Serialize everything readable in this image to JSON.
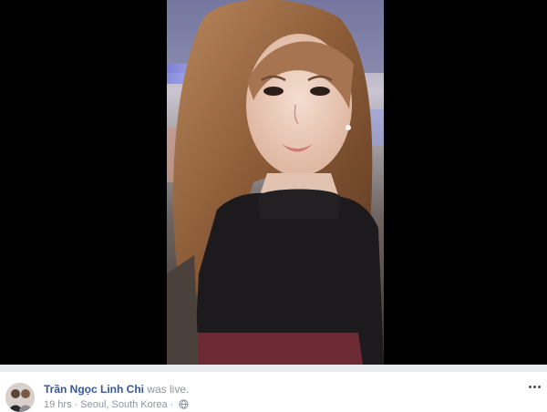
{
  "video": {
    "description_icon": "live-video-frame"
  },
  "post": {
    "author_name": "Trần Ngọc Linh Chi",
    "action_text": " was live.",
    "time": "19 hrs",
    "separator": "·",
    "location": "Seoul, South Korea",
    "audience_icon": "globe-icon",
    "more_icon": "more-options-icon"
  },
  "colors": {
    "author_link": "#365899",
    "meta_text": "#90949c",
    "separator_bg": "#e9ebee",
    "video_bg": "#000000"
  }
}
